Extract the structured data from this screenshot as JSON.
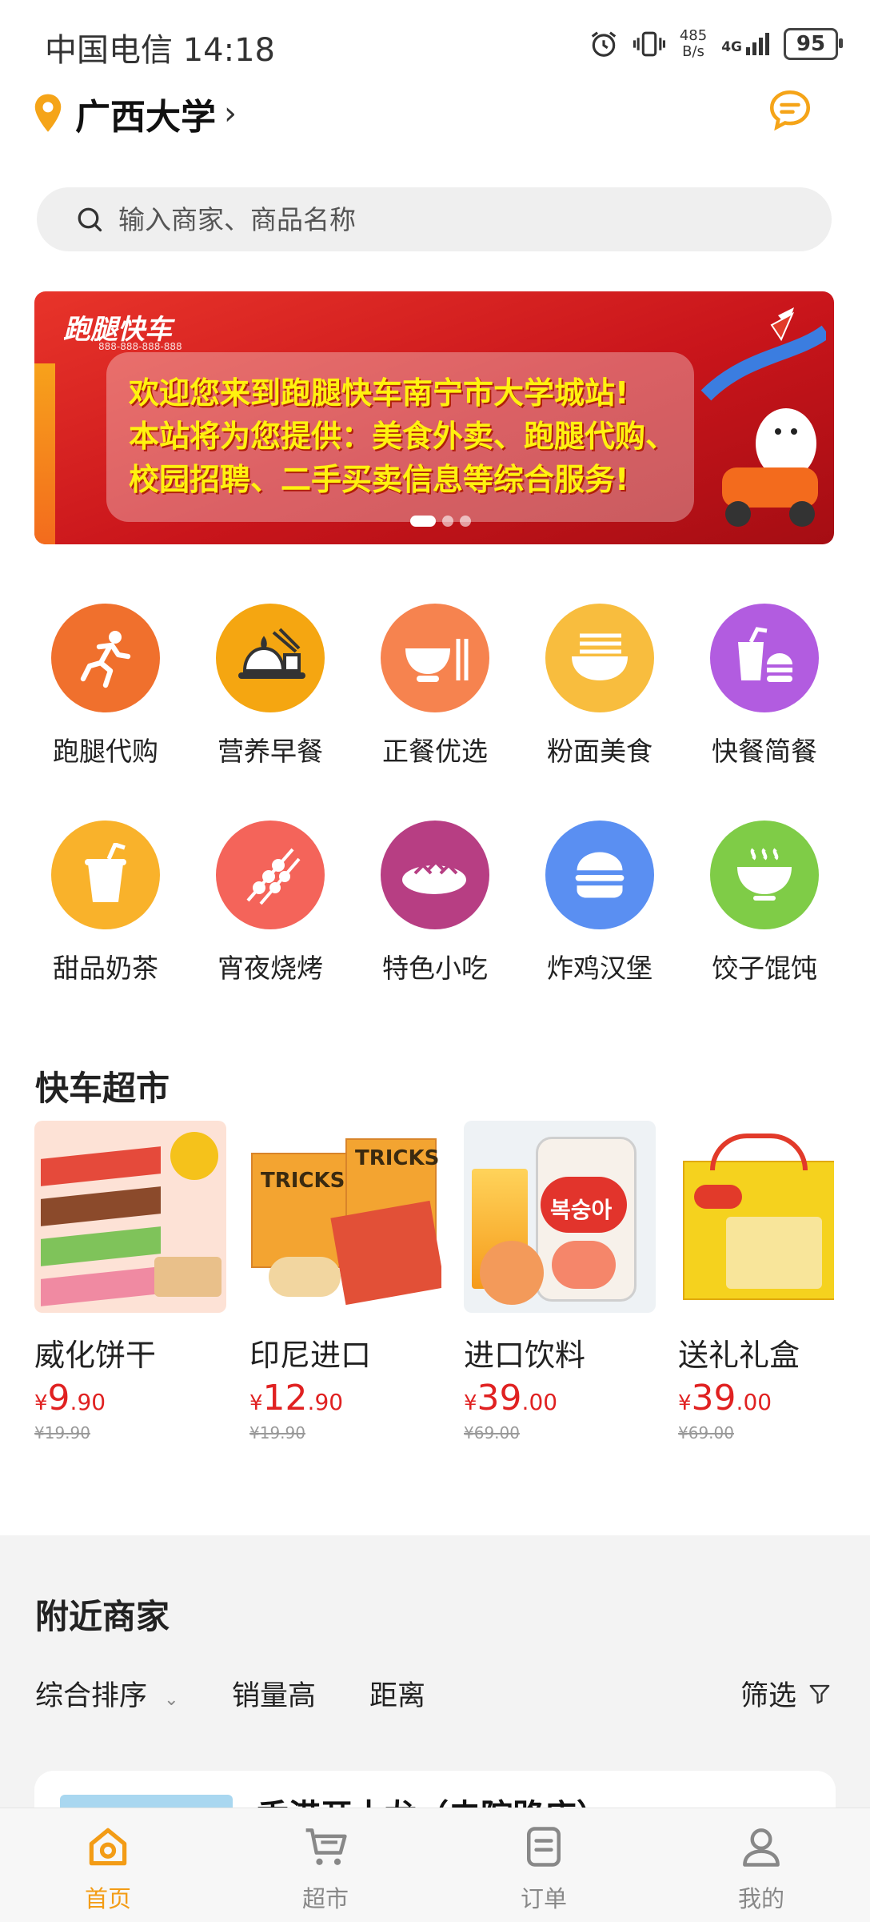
{
  "status_bar": {
    "carrier_time": "中国电信 14:18",
    "net_speed_value": "485",
    "net_speed_unit": "B/s",
    "network": "4G",
    "battery": "95"
  },
  "header": {
    "location": "广西大学",
    "location_icon": "map-pin-icon",
    "message_icon": "message-icon"
  },
  "search": {
    "placeholder": "输入商家、商品名称"
  },
  "banner": {
    "logo": "跑腿快车",
    "logo_sub": "888-888-888-888",
    "lines": [
      "欢迎您来到跑腿快车南宁市大学城站!",
      "本站将为您提供：美食外卖、跑腿代购、",
      "校园招聘、二手买卖信息等综合服务!"
    ],
    "slide_index": 0
  },
  "categories": [
    {
      "label": "跑腿代购",
      "icon": "runner-icon",
      "color": "#f0702d"
    },
    {
      "label": "营养早餐",
      "icon": "breakfast-icon",
      "color": "#f5a611"
    },
    {
      "label": "正餐优选",
      "icon": "bowl-icon",
      "color": "#f6834f"
    },
    {
      "label": "粉面美食",
      "icon": "noodle-icon",
      "color": "#f8bd3e"
    },
    {
      "label": "快餐简餐",
      "icon": "fastfood-icon",
      "color": "#b25ce0"
    },
    {
      "label": "甜品奶茶",
      "icon": "milk-tea-icon",
      "color": "#f9b22b"
    },
    {
      "label": "宵夜烧烤",
      "icon": "skewer-icon",
      "color": "#f4645a"
    },
    {
      "label": "特色小吃",
      "icon": "snack-icon",
      "color": "#b73e83"
    },
    {
      "label": "炸鸡汉堡",
      "icon": "burger-icon",
      "color": "#5a8ff2"
    },
    {
      "label": "饺子馄饨",
      "icon": "soup-bowl-icon",
      "color": "#7fcc47"
    }
  ],
  "market": {
    "title": "快车超市",
    "products": [
      {
        "name": "威化饼干",
        "currency": "¥",
        "price_int": "9",
        "price_dec": ".90",
        "original": "¥19.90"
      },
      {
        "name": "印尼进口",
        "currency": "¥",
        "price_int": "12",
        "price_dec": ".90",
        "original": "¥19.90"
      },
      {
        "name": "进口饮料",
        "currency": "¥",
        "price_int": "39",
        "price_dec": ".00",
        "original": "¥69.00"
      },
      {
        "name": "送礼礼盒",
        "currency": "¥",
        "price_int": "39",
        "price_dec": ".00",
        "original": "¥69.00"
      }
    ]
  },
  "nearby": {
    "title": "附近商家",
    "sort": [
      "综合排序",
      "销量高",
      "距离"
    ],
    "filter": "筛选",
    "first_shop": "香港开十龙（史院路店）"
  },
  "tabbar": [
    {
      "label": "首页",
      "icon": "home-icon",
      "active": true
    },
    {
      "label": "超市",
      "icon": "cart-icon",
      "active": false
    },
    {
      "label": "订单",
      "icon": "order-icon",
      "active": false
    },
    {
      "label": "我的",
      "icon": "profile-icon",
      "active": false
    }
  ],
  "colors": {
    "accent": "#f39c16",
    "price": "#e02121"
  }
}
